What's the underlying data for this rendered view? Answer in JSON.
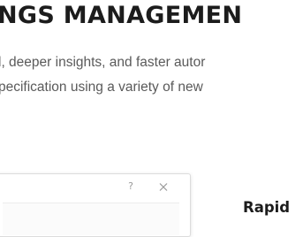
{
  "hero": {
    "headline": "NGS MANAGEMEN",
    "subline_1": "l, deeper insights, and faster autor",
    "subline_2": "pecification using a variety of new"
  },
  "dialog": {
    "help_label": "?",
    "close_icon": "close-icon"
  },
  "side_section": {
    "title": "Rapid"
  },
  "colors": {
    "headline": "#1c1c1c",
    "body_text": "#5a5a5a",
    "dialog_border": "#dcdcdc",
    "dialog_icons": "#9a9a9a"
  }
}
